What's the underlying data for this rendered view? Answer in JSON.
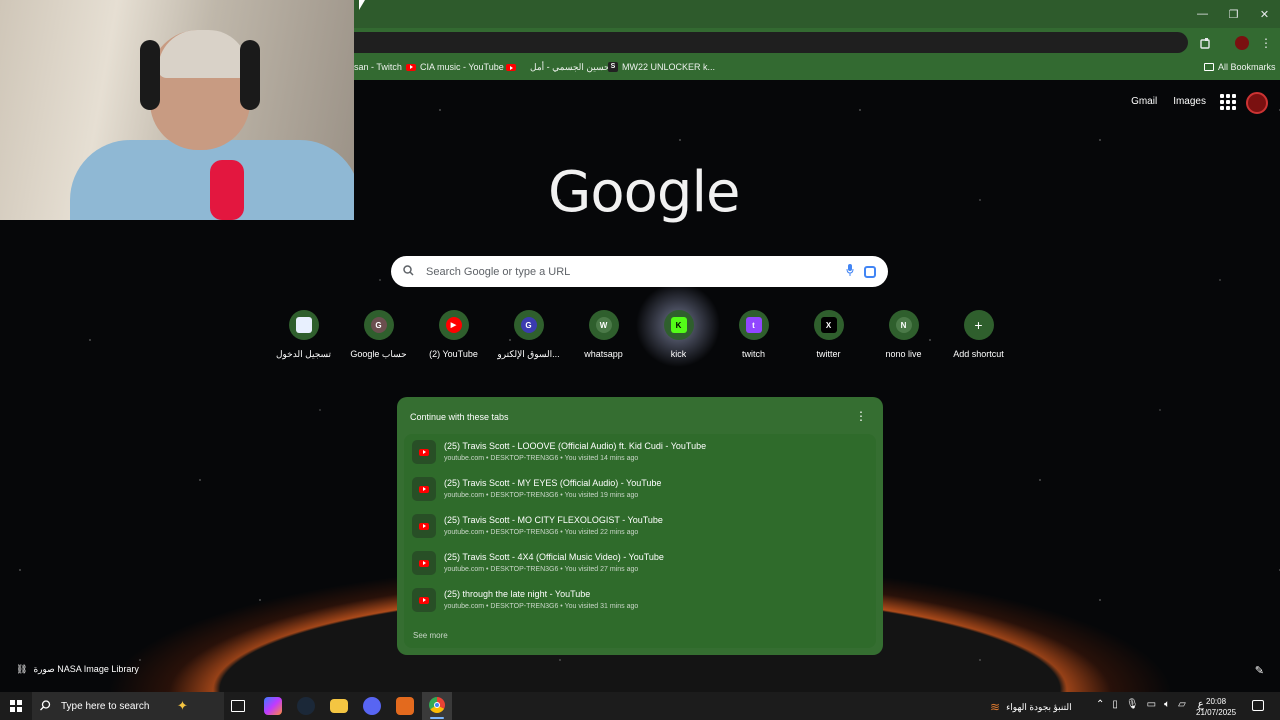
{
  "window": {
    "minimize": "—",
    "restore": "❐",
    "close": "✕"
  },
  "bookmarks": [
    {
      "label": "san - Twitch",
      "icon": "none"
    },
    {
      "label": "CIA music - YouTube",
      "icon": "youtube"
    },
    {
      "label": "",
      "icon": "youtube"
    },
    {
      "label": "حسين الجسمي - أمل...",
      "icon": "none"
    },
    {
      "label": "MW22 UNLOCKER k...",
      "icon": "s-badge"
    }
  ],
  "all_bookmarks": "All Bookmarks",
  "ntp": {
    "gmail": "Gmail",
    "images": "Images",
    "logo": "Google",
    "search_placeholder": "Search Google or type a URL",
    "shortcuts": [
      {
        "label": "تسجيل الدخول",
        "letter": "",
        "color": "#e8f0fe"
      },
      {
        "label": "Google حساب",
        "letter": "G",
        "color": "#6b4f4f"
      },
      {
        "label": "(2) YouTube",
        "letter": "▶",
        "color": "#ff0000"
      },
      {
        "label": "السوق الإلكترو...",
        "letter": "G",
        "color": "#3b3bb0"
      },
      {
        "label": "whatsapp",
        "letter": "W",
        "color": "#4b7a48"
      },
      {
        "label": "kick",
        "letter": "K",
        "color": "#53fc18"
      },
      {
        "label": "twitch",
        "letter": "t",
        "color": "#9146ff"
      },
      {
        "label": "twitter",
        "letter": "X",
        "color": "#000000"
      },
      {
        "label": "nono live",
        "letter": "N",
        "color": "#4b7a48"
      },
      {
        "label": "Add shortcut",
        "letter": "+",
        "color": "#2f5f2d"
      }
    ],
    "tabs_card": {
      "title": "Continue with these tabs",
      "menu": "⋮",
      "items": [
        {
          "title": "(25) Travis Scott - LOOOVE (Official Audio) ft. Kid Cudi - YouTube",
          "meta": "youtube.com • DESKTOP-TREN3G6 • You visited 14 mins ago"
        },
        {
          "title": "(25) Travis Scott - MY EYES (Official Audio) - YouTube",
          "meta": "youtube.com • DESKTOP-TREN3G6 • You visited 19 mins ago"
        },
        {
          "title": "(25) Travis Scott - MO CITY FLEXOLOGIST - YouTube",
          "meta": "youtube.com • DESKTOP-TREN3G6 • You visited 22 mins ago"
        },
        {
          "title": "(25) Travis Scott - 4X4 (Official Music Video) - YouTube",
          "meta": "youtube.com • DESKTOP-TREN3G6 • You visited 27 mins ago"
        },
        {
          "title": "(25) through the late night - YouTube",
          "meta": "youtube.com • DESKTOP-TREN3G6 • You visited 31 mins ago"
        }
      ],
      "see_more": "See more"
    },
    "attribution": "صورة NASA Image Library"
  },
  "taskbar": {
    "search_placeholder": "Type here to search",
    "weather": "التنبؤ بجودة الهواء",
    "lang": "ع",
    "time": "20:08",
    "date": "21/07/2025"
  }
}
